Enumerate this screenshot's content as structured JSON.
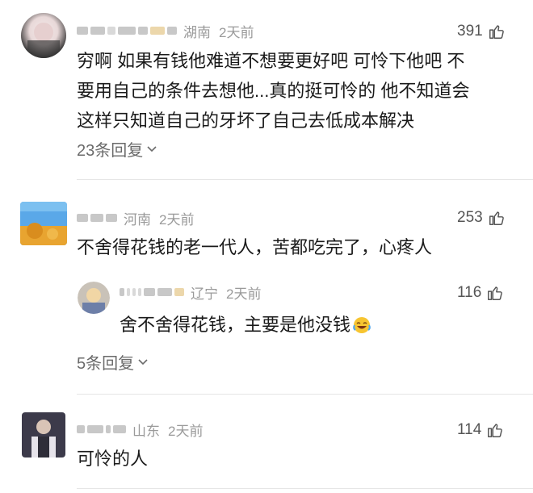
{
  "comments": [
    {
      "location": "湖南",
      "time": "2天前",
      "likes": "391",
      "text_lines": [
        "穷啊 如果有钱他难道不想要更好吧 可怜下他吧 不",
        "要用自己的条件去想他...真的挺可怜的 他不知道会",
        "这样只知道自己的牙坏了自己去低成本解决"
      ],
      "replies_label": "23条回复"
    },
    {
      "location": "河南",
      "time": "2天前",
      "likes": "253",
      "text": "不舍得花钱的老一代人，苦都吃完了，心疼人",
      "reply": {
        "location": "辽宁",
        "time": "2天前",
        "likes": "116",
        "text": "舍不舍得花钱，主要是他没钱",
        "emoji": "crying-laughing-emoji"
      },
      "replies_label": "5条回复"
    },
    {
      "location": "山东",
      "time": "2天前",
      "likes": "114",
      "text": "可怜的人"
    }
  ],
  "icons": {
    "like": "thumbs-up-icon",
    "expand": "chevron-down-icon"
  },
  "colors": {
    "meta": "#9a9a9a",
    "text": "#1a1a1a",
    "divider": "#e6e6e6"
  }
}
